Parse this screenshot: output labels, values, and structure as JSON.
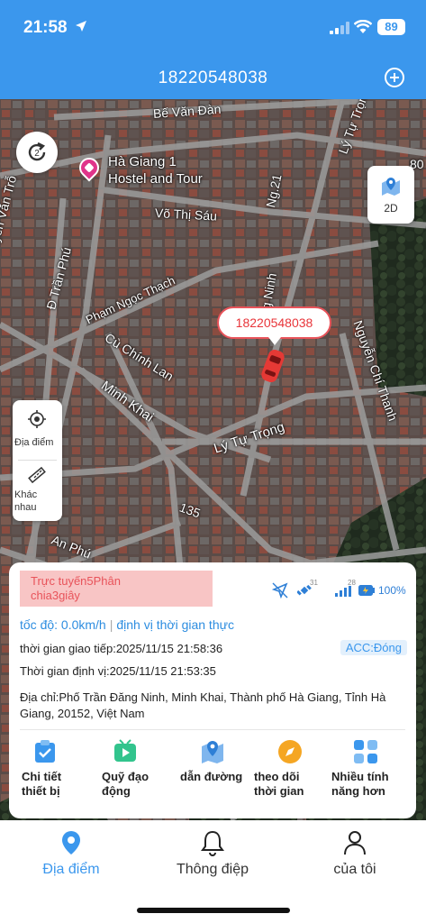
{
  "status_bar": {
    "time": "21:58",
    "battery": "89",
    "icons": [
      "location-arrow-icon",
      "signal-icon",
      "wifi-icon",
      "battery-icon"
    ]
  },
  "header": {
    "title": "18220548038",
    "add_icon": "plus-circle-icon"
  },
  "map": {
    "road_labels": {
      "be_van_dan": "Bế Văn Đàn",
      "ly_tu_trong_top": "Lý Tự Trọng",
      "ng_21": "Ng.21",
      "vo_thi_sau": "Võ Thị Sáu",
      "tran_phu_d": "Đ Trần Phú",
      "tran_phu_top": "yễn Văn Trỗ",
      "pham_ngoc_thach": "Phạm Ngọc Thạch",
      "nguyen_chi_thanh": "Nguyễn Chí Thanh",
      "cu_chinh_lan": "Cù Chính Lan",
      "minh_khai": "Minh Khai",
      "ly_tu_trong": "Lý Tự Trọng",
      "road_135": "135",
      "an_phu": "An Phú",
      "ng_ninh": "g Ninh",
      "edge_80": "80"
    },
    "poi": {
      "label_line1": "Hà Giang 1",
      "label_line2": "Hostel and Tour"
    },
    "view_mode": "2D",
    "side_panel": {
      "location_label": "Địa điểm",
      "other_label_line1": "Khác",
      "other_label_line2": "nhau"
    },
    "device_tag": "18220548038",
    "refresh_badge": "2"
  },
  "card": {
    "status_line1": "Trực tuyến5Phân",
    "status_line2": "chia3giây",
    "gps_value": "31",
    "gsm_value": "28",
    "battery_percent": "100%",
    "speed": "tốc độ: 0.0km/h",
    "positioning": "định vị thời gian thực",
    "comm_time": "thời gian giao tiếp:2025/11/15 21:58:36",
    "acc": "ACC:Đóng",
    "locate_time": "Thời gian định vị:2025/11/15 21:53:35",
    "address": "Địa chỉ:Phố Trần Đăng Ninh, Minh Khai, Thành phố Hà Giang, Tỉnh Hà Giang, 20152, Việt Nam",
    "actions": [
      {
        "line1": "Chi tiết",
        "line2": "thiết bị",
        "icon": "clipboard-check-icon"
      },
      {
        "line1": "Quỹ đạo",
        "line2": "động",
        "icon": "video-play-icon"
      },
      {
        "line1": "dẫn đường",
        "line2": "",
        "icon": "map-pin-icon"
      },
      {
        "line1": "theo dõi",
        "line2": "thời gian",
        "icon": "compass-icon"
      },
      {
        "line1": "Nhiều tính",
        "line2": "năng hơn",
        "icon": "grid-apps-icon"
      }
    ]
  },
  "tabs": [
    {
      "label": "Địa điểm",
      "icon": "location-pin-icon",
      "active": true
    },
    {
      "label": "Thông điệp",
      "icon": "bell-icon",
      "active": false
    },
    {
      "label": "của tôi",
      "icon": "user-icon",
      "active": false
    }
  ],
  "colors": {
    "primary": "#3b97ed",
    "alert": "#e8535a",
    "pill_bg": "#f8c5c5"
  }
}
